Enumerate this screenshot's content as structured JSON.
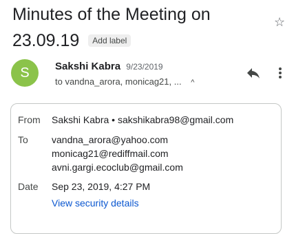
{
  "subject": {
    "line1": "Minutes of the Meeting on",
    "line2": "23.09.19",
    "add_label": "Add label"
  },
  "sender": {
    "avatar_letter": "S",
    "avatar_color": "#8bc34a",
    "name": "Sakshi Kabra",
    "date": "9/23/2019",
    "to_summary": "to vandna_arora, monicag21, ..."
  },
  "icons": {
    "star": "star-outline-icon",
    "reply": "reply-icon",
    "more": "more-vert-icon",
    "caret": "caret-up-icon"
  },
  "details": {
    "from_label": "From",
    "from_value": "Sakshi Kabra • sakshikabra98@gmail.com",
    "to_label": "To",
    "to_values": [
      "vandna_arora@yahoo.com",
      "monicag21@rediffmail.com",
      "avni.gargi.ecoclub@gmail.com"
    ],
    "date_label": "Date",
    "date_value": "Sep 23, 2019, 4:27 PM",
    "security_link": "View security details",
    "link_color": "#0b57d0"
  }
}
